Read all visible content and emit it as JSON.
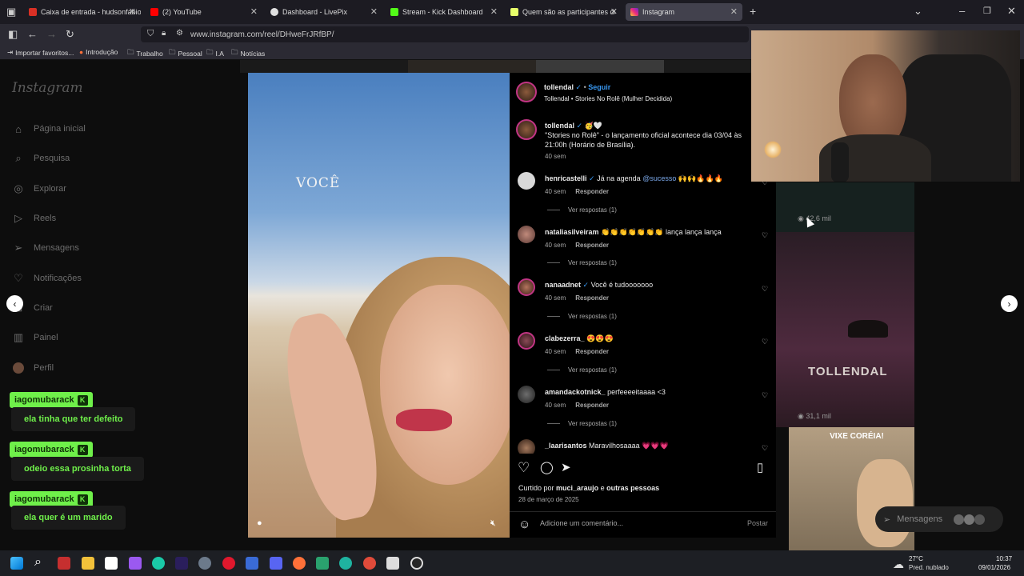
{
  "browser": {
    "tabs": [
      {
        "label": "Caixa de entrada - hudsonfabiom",
        "color": "#d93025"
      },
      {
        "label": "(2) YouTube",
        "color": "#ff0000"
      },
      {
        "label": "Dashboard - LivePix",
        "color": "#e0e0e0"
      },
      {
        "label": "Stream - Kick Dashboard",
        "color": "#53fc18"
      },
      {
        "label": "Quem são as participantes de M",
        "color": "#e7ff6a"
      },
      {
        "label": "Instagram",
        "color": "#e1306c"
      }
    ],
    "url": "www.instagram.com/reel/DHweFrJRfBP/",
    "bookmarks": [
      "Importar favoritos...",
      "Introdução",
      "Trabalho",
      "Pessoal",
      "I.A",
      "Notícias"
    ]
  },
  "instagram": {
    "logo": "Instagram",
    "nav": [
      "Página inicial",
      "Pesquisa",
      "Explorar",
      "Reels",
      "Mensagens",
      "Notificações",
      "Criar",
      "Painel",
      "Perfil"
    ],
    "nav_icons": [
      "home-icon",
      "search-icon",
      "compass-icon",
      "reels-icon",
      "messenger-icon",
      "heart-icon",
      "plus-icon",
      "dashboard-icon",
      "avatar"
    ]
  },
  "chat": [
    {
      "user": "iagomubarack",
      "message": "ela tinha que ter defeito"
    },
    {
      "user": "iagomubarack",
      "message": "odeio essa prosinha torta"
    },
    {
      "user": "iagomubarack",
      "message": "ela quer é um marido"
    }
  ],
  "video": {
    "overlay_text": "VOCÊ"
  },
  "post": {
    "author": "tollendal",
    "follow": "Seguir",
    "audio": "Tollendal • Stories No Rolê (Mulher Decidida)",
    "caption_user": "tollendal",
    "caption_emoji": "🥳🤍",
    "caption_line1": "\"Stories no Rolê\" - o lançamento oficial acontece dia 03/04 às",
    "caption_line2": "21:00h (Horário de Brasília).",
    "caption_time": "40 sem",
    "comments": [
      {
        "user": "henricastelli",
        "text": "Já na agenda",
        "mention": "@sucesso",
        "emoji": "🙌🙌🔥🔥🔥",
        "time": "40 sem",
        "reply": "Responder",
        "replies": "Ver respostas (1)"
      },
      {
        "user": "nataliasilveiram",
        "text": "👏👏👏👏👏👏👏",
        "extra": "lança lança lança",
        "time": "40 sem",
        "reply": "Responder",
        "replies": "Ver respostas (1)"
      },
      {
        "user": "nanaadnet",
        "text": "Você é tudooooooo",
        "time": "40 sem",
        "reply": "Responder",
        "replies": "Ver respostas (1)"
      },
      {
        "user": "clabezerra_",
        "text": "😍😍😍",
        "time": "40 sem",
        "reply": "Responder",
        "replies": "Ver respostas (1)"
      },
      {
        "user": "amandackotnick_",
        "text": "perfeeeeitaaaa <3",
        "time": "40 sem",
        "reply": "Responder",
        "replies": "Ver respostas (1)"
      },
      {
        "user": "_laarisantos",
        "text": "Maravilhosaaaa",
        "emoji": "💗💗💗"
      }
    ],
    "liked_by_prefix": "Curtido por",
    "liked_by_user": "muci_araujo",
    "liked_by_and": "e",
    "liked_by_others": "outras pessoas",
    "date": "28 de março de 2025",
    "comment_placeholder": "Adicione um comentário...",
    "post_button": "Postar"
  },
  "grid": {
    "views1": "42,6 mil",
    "views2": "31,1 mil",
    "tile_text": "TOLLENDAL",
    "tile_text2": "VIXE CORÉIA!",
    "messages_label": "Mensagens"
  },
  "taskbar": {
    "weather_temp": "27°C",
    "weather_desc": "Pred. nublado",
    "time": "10:37",
    "date": "09/01/2026"
  }
}
